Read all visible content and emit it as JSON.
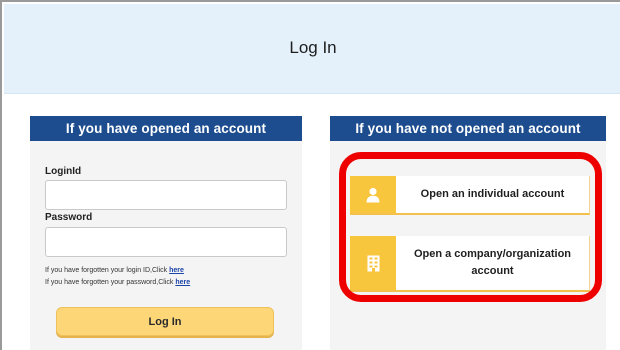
{
  "header": {
    "title": "Log In"
  },
  "left_card": {
    "heading": "If you have opened an account",
    "login_id_label": "LoginId",
    "login_id_value": "",
    "password_label": "Password",
    "password_value": "",
    "forgot_id_text": "If you have forgotten your login ID,Click ",
    "forgot_id_link": "here",
    "forgot_pw_text": "If you have forgotten your password,Click ",
    "forgot_pw_link": "here",
    "login_button": "Log In"
  },
  "right_card": {
    "heading": "If you have not opened an account",
    "individual_button": "Open an individual account",
    "individual_icon": "person-icon",
    "company_button": "Open a company/organization account",
    "company_icon": "building-icon"
  },
  "colors": {
    "header_bg": "#e4f1fb",
    "card_heading_bg": "#1d4d8f",
    "button_yellow": "#fdd678",
    "icon_yellow": "#f8c63c",
    "highlight_red": "#ee0000"
  }
}
